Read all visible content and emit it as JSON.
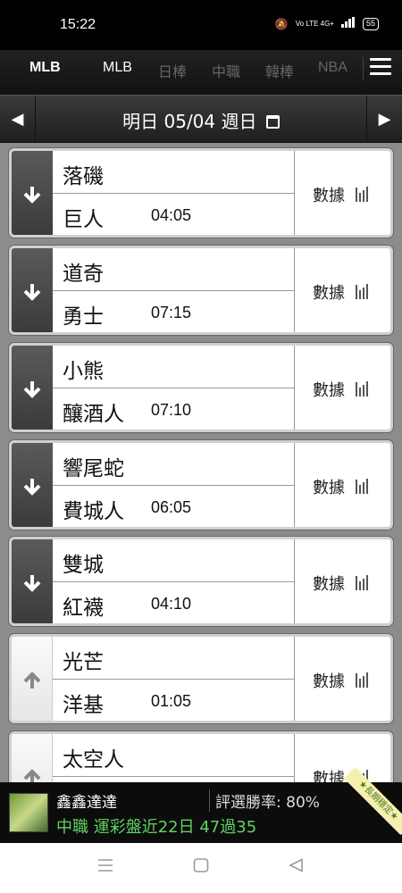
{
  "status_bar": {
    "time": "15:22",
    "signal_text": "Vo LTE 4G+",
    "battery": "55"
  },
  "league_tabs": [
    {
      "label": "MLB",
      "active": true
    },
    {
      "label": "MLB",
      "active": false
    },
    {
      "label": "日棒",
      "active": false
    },
    {
      "label": "中職",
      "active": false
    },
    {
      "label": "韓棒",
      "active": false
    },
    {
      "label": "NBA",
      "active": false
    }
  ],
  "date_bar": {
    "label": "明日 05/04 週日"
  },
  "games": [
    {
      "away": "落磯",
      "home": "巨人",
      "time": "04:05",
      "direction": "down",
      "stats_label": "數據"
    },
    {
      "away": "道奇",
      "home": "勇士",
      "time": "07:15",
      "direction": "down",
      "stats_label": "數據"
    },
    {
      "away": "小熊",
      "home": "釀酒人",
      "time": "07:10",
      "direction": "down",
      "stats_label": "數據"
    },
    {
      "away": "響尾蛇",
      "home": "費城人",
      "time": "06:05",
      "direction": "down",
      "stats_label": "數據"
    },
    {
      "away": "雙城",
      "home": "紅襪",
      "time": "04:10",
      "direction": "down",
      "stats_label": "數據"
    },
    {
      "away": "光芒",
      "home": "洋基",
      "time": "01:05",
      "direction": "up",
      "stats_label": "數據"
    },
    {
      "away": "太空人",
      "home": "",
      "time": "",
      "direction": "up",
      "stats_label": "數據"
    }
  ],
  "ad_banner": {
    "name": "鑫鑫達達",
    "win_rate": "評選勝率: 80%",
    "record": "中職 運彩盤近22日 47過35",
    "ribbon": "★長期穩定★"
  },
  "colors": {
    "accent_green": "#5fd35f",
    "list_bg": "#8c8c8c",
    "header_bg": "#1f1f1f"
  }
}
